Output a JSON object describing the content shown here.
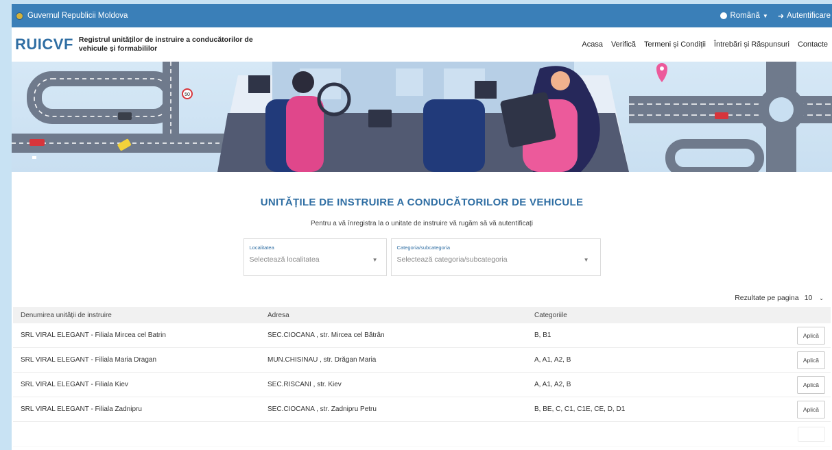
{
  "gov_bar": {
    "title": "Guvernul Republicii Moldova",
    "language": "Română",
    "login": "Autentificare"
  },
  "header": {
    "logo": "RUICVF",
    "subtitle": "Registrul unităților de instruire a conducătorilor de vehicule și formabililor",
    "nav": [
      "Acasa",
      "Verifică",
      "Termeni și Condiții",
      "Întrebări și Răspunsuri",
      "Contacte"
    ]
  },
  "banner": {
    "speed_sign": "50"
  },
  "main": {
    "title": "UNITĂȚILE DE INSTRUIRE A CONDUCĂTORILOR DE VEHICULE",
    "subtitle": "Pentru a vă înregistra la o unitate de instruire vă rugăm să vă autentificați",
    "filters": {
      "locality_label": "Localitatea",
      "locality_placeholder": "Selectează localitatea",
      "category_label": "Categoria/subcategoria",
      "category_placeholder": "Selectează categoria/subcategoria"
    },
    "results_per_page_label": "Rezultate pe pagina",
    "results_per_page_value": "10"
  },
  "table": {
    "headers": [
      "Denumirea unității de instruire",
      "Adresa",
      "Categoriile"
    ],
    "apply_label": "Aplică",
    "rows": [
      {
        "name": "SRL VIRAL ELEGANT - Filiala Mircea cel Batrin",
        "address": "SEC.CIOCANA , str. Mircea cel Bătrân",
        "categories": "B, B1"
      },
      {
        "name": "SRL VIRAL ELEGANT - Filiala Maria Dragan",
        "address": "MUN.CHISINAU , str. Drăgan Maria",
        "categories": "A, A1, A2, B"
      },
      {
        "name": "SRL VIRAL ELEGANT - Filiala Kiev",
        "address": "SEC.RISCANI , str. Kiev",
        "categories": "A, A1, A2, B"
      },
      {
        "name": "SRL VIRAL ELEGANT - Filiala Zadnipru",
        "address": "SEC.CIOCANA , str. Zadnipru Petru",
        "categories": "B, BE, C, C1, C1E, CE, D, D1"
      }
    ]
  }
}
